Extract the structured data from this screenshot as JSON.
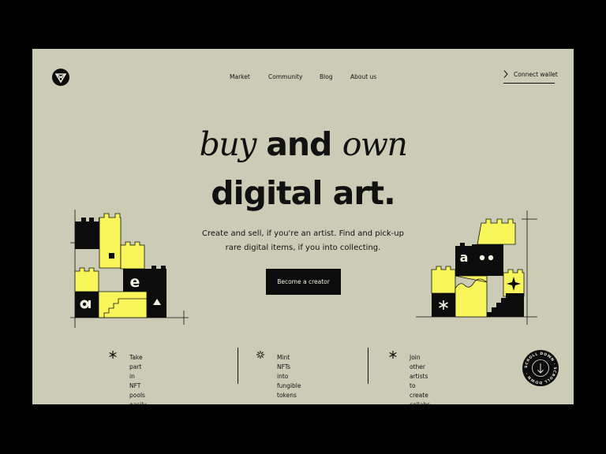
{
  "nav": {
    "items": [
      "Market",
      "Community",
      "Blog",
      "About us"
    ],
    "connect_label": "Connect wallet"
  },
  "hero": {
    "title_word1": "buy",
    "title_word2": "and",
    "title_word3": "own",
    "title_line2": "digital art.",
    "subtitle_line1": "Create and sell, if you're an artist. Find and pick-up",
    "subtitle_line2": "rare digital items, if you into collecting.",
    "cta_label": "Become a creator"
  },
  "art_left": {
    "letter": "e"
  },
  "art_right": {
    "letter": "a"
  },
  "features": [
    {
      "icon": "asterisk-icon",
      "line1": "Take part in NFT pools",
      "line2": "easily"
    },
    {
      "icon": "sparkle-asterisk-icon",
      "line1": "Mint NFTs into",
      "line2": "fungible tokens"
    },
    {
      "icon": "asterisk-icon",
      "line1": "Join other artists to",
      "line2": "create collabs"
    }
  ],
  "scroll_badge": {
    "text": "SCROLL DOWN · SCROLL DOWN ·"
  },
  "colors": {
    "background": "#ccccb6",
    "dark": "#0c0c0c",
    "accent_yellow": "#f7f55a"
  }
}
